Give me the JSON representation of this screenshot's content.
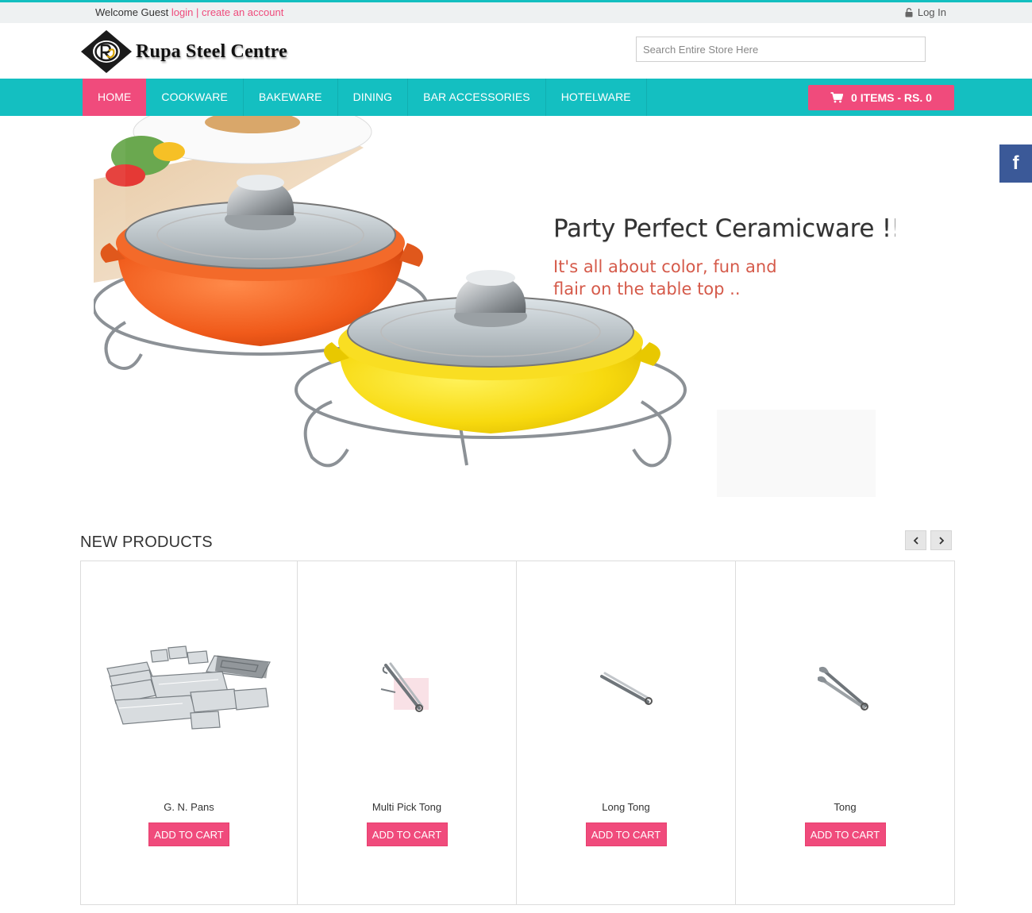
{
  "topbar": {
    "welcome_text": "Welcome Guest",
    "login_link": "login",
    "separator": "|",
    "create_account_link": "create an account",
    "login_label": "Log In",
    "login_icon": "lock-icon"
  },
  "header": {
    "logo_text": "Rupa Steel Centre",
    "search_placeholder": "Search Entire Store Here"
  },
  "nav": {
    "items": [
      {
        "label": "HOME",
        "active": true
      },
      {
        "label": "COOKWARE",
        "active": false
      },
      {
        "label": "BAKEWARE",
        "active": false
      },
      {
        "label": "DINING",
        "active": false
      },
      {
        "label": "BAR ACCESSORIES",
        "active": false
      },
      {
        "label": "HOTELWARE",
        "active": false
      }
    ],
    "cart_label": "0 ITEMS - RS. 0",
    "cart_icon": "shopping-cart-icon"
  },
  "social": {
    "facebook_label": "f"
  },
  "banner": {
    "headline": "Party Perfect Ceramicware !!",
    "subline": "It's all about color, fun and flair on the table top .."
  },
  "new_products": {
    "title": "NEW PRODUCTS",
    "prev_icon": "chevron-left-icon",
    "next_icon": "chevron-right-icon",
    "items": [
      {
        "name": "G. N. Pans",
        "button": "ADD TO CART"
      },
      {
        "name": "Multi Pick Tong",
        "button": "ADD TO CART"
      },
      {
        "name": "Long Tong",
        "button": "ADD TO CART"
      },
      {
        "name": "Tong",
        "button": "ADD TO CART"
      }
    ]
  },
  "colors": {
    "teal": "#14bfc1",
    "pink": "#f04b7c",
    "facebook": "#3b5998"
  }
}
